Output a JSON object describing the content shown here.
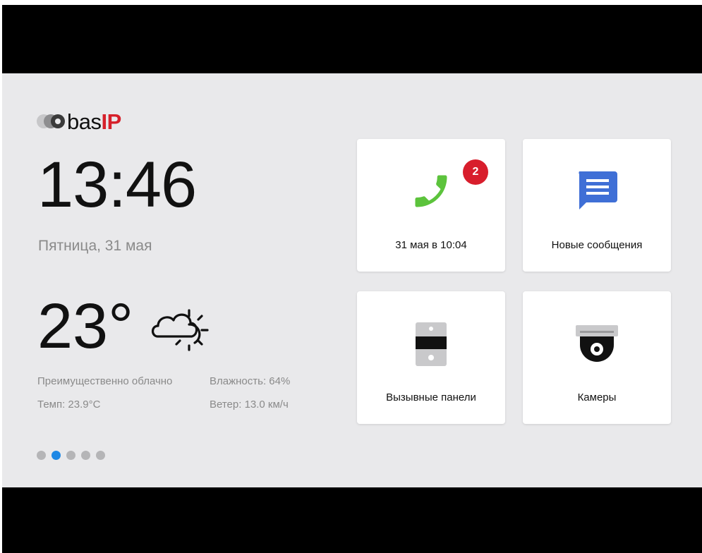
{
  "logo": {
    "text_bas": "bas",
    "text_ip": "IP"
  },
  "time": "13:46",
  "date": "Пятница, 31 мая",
  "weather": {
    "temperature": "23°",
    "condition": "Преимущественно облачно",
    "humidity": "Влажность: 64%",
    "temp_detail": "Темп: 23.9°C",
    "wind": "Ветер: 13.0 км/ч",
    "icon": "cloud-sun-icon"
  },
  "pager": {
    "count": 5,
    "active_index": 1
  },
  "tiles": [
    {
      "id": "calls",
      "label": "31 мая в 10:04",
      "icon": "phone-icon",
      "badge": "2"
    },
    {
      "id": "messages",
      "label": "Новые сообщения",
      "icon": "message-icon"
    },
    {
      "id": "panels",
      "label": "Вызывные панели",
      "icon": "door-panel-icon"
    },
    {
      "id": "cameras",
      "label": "Камеры",
      "icon": "camera-icon"
    }
  ],
  "colors": {
    "accent": "#1e88e5",
    "badge": "#d81e2c",
    "phone": "#5cc33c",
    "message": "#3f6fd6",
    "brand_red": "#d6202a"
  }
}
